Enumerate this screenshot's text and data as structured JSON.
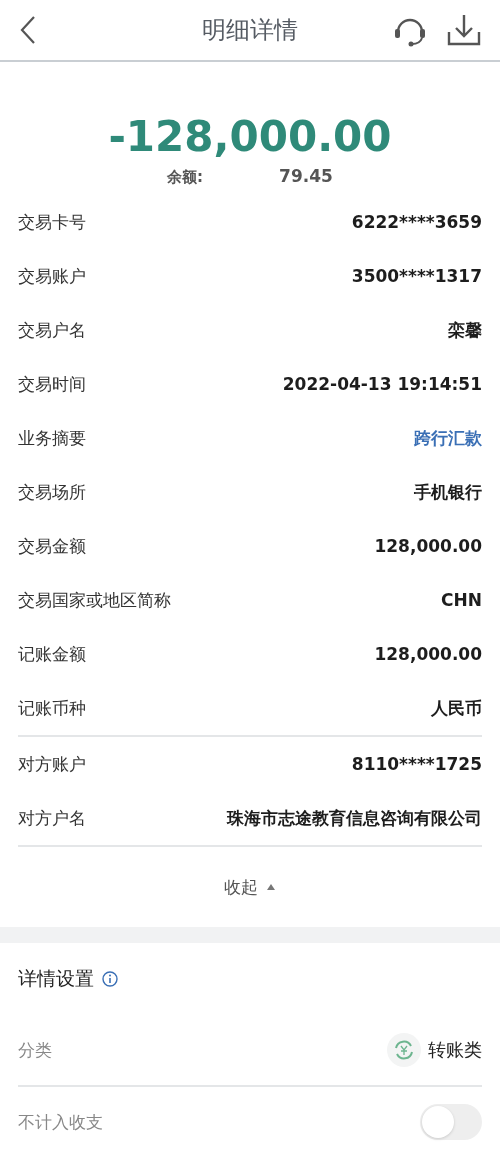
{
  "header": {
    "title": "明细详情"
  },
  "summary": {
    "amount": "-128,000.00",
    "balance_label": "余额:",
    "balance_value": "79.45"
  },
  "details": [
    {
      "label": "交易卡号",
      "value": "6222****3659",
      "kind": "text"
    },
    {
      "label": "交易账户",
      "value": "3500****1317",
      "kind": "text"
    },
    {
      "label": "交易户名",
      "value": "栾馨",
      "kind": "text"
    },
    {
      "label": "交易时间",
      "value": "2022-04-13 19:14:51",
      "kind": "text"
    },
    {
      "label": "业务摘要",
      "value": "跨行汇款",
      "kind": "link"
    },
    {
      "label": "交易场所",
      "value": "手机银行",
      "kind": "text"
    },
    {
      "label": "交易金额",
      "value": "128,000.00",
      "kind": "text"
    },
    {
      "label": "交易国家或地区简称",
      "value": "CHN",
      "kind": "text"
    },
    {
      "label": "记账金额",
      "value": "128,000.00",
      "kind": "text"
    },
    {
      "label": "记账币种",
      "value": "人民币",
      "kind": "text"
    }
  ],
  "counterparty": [
    {
      "label": "对方账户",
      "value": "8110****1725"
    },
    {
      "label": "对方户名",
      "value": "珠海市志途教育信息咨询有限公司"
    }
  ],
  "collapse": {
    "label": "收起",
    "expanded": true
  },
  "settings": {
    "title": "详情设置",
    "category_label": "分类",
    "category_value": "转账类",
    "exclude_label": "不计入收支",
    "exclude_on": false
  }
}
